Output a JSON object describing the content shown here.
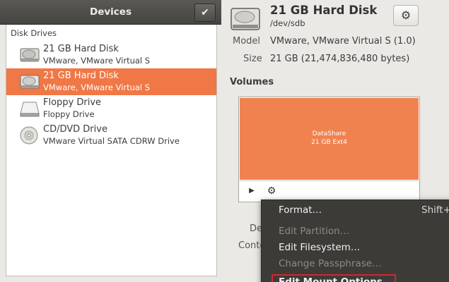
{
  "sidebar": {
    "title": "Devices",
    "check_icon": "✔",
    "section_label": "Disk Drives",
    "devices": [
      {
        "name": "21 GB Hard Disk",
        "sub": "VMware, VMware Virtual S",
        "icon": "hard-disk-icon",
        "selected": false
      },
      {
        "name": "21 GB Hard Disk",
        "sub": "VMware, VMware Virtual S",
        "icon": "hard-disk-icon",
        "selected": true
      },
      {
        "name": "Floppy Drive",
        "sub": "Floppy Drive",
        "icon": "floppy-drive-icon",
        "selected": false
      },
      {
        "name": "CD/DVD Drive",
        "sub": "VMware Virtual SATA CDRW Drive",
        "icon": "optical-drive-icon",
        "selected": false
      }
    ]
  },
  "disk": {
    "title": "21 GB Hard Disk",
    "path": "/dev/sdb",
    "gear_icon": "⚙",
    "model_label": "Model",
    "model_value": "VMware, VMware Virtual S (1.0)",
    "size_label": "Size",
    "size_value": "21 GB (21,474,836,480 bytes)"
  },
  "volumes": {
    "title": "Volumes",
    "volume_name": "DataShare",
    "volume_desc": "21 GB Ext4",
    "play_icon": "▶",
    "settings_icon": "⚙"
  },
  "partial_labels": {
    "device_label": "De",
    "contents_label": "Conte"
  },
  "context_menu": {
    "items": [
      {
        "label": "Format…",
        "enabled": true,
        "shortcut": "Shift+"
      },
      {
        "label": "Edit Partition…",
        "enabled": false,
        "shortcut": ""
      },
      {
        "label": "Edit Filesystem…",
        "enabled": true,
        "shortcut": ""
      },
      {
        "label": "Change Passphrase…",
        "enabled": false,
        "shortcut": ""
      },
      {
        "label": "Edit Mount Options…",
        "enabled": true,
        "shortcut": ""
      }
    ]
  },
  "colors": {
    "selection": "#f07746",
    "volume": "#f0824f",
    "menu_bg": "#3c3b37",
    "highlight": "#d8262a"
  }
}
